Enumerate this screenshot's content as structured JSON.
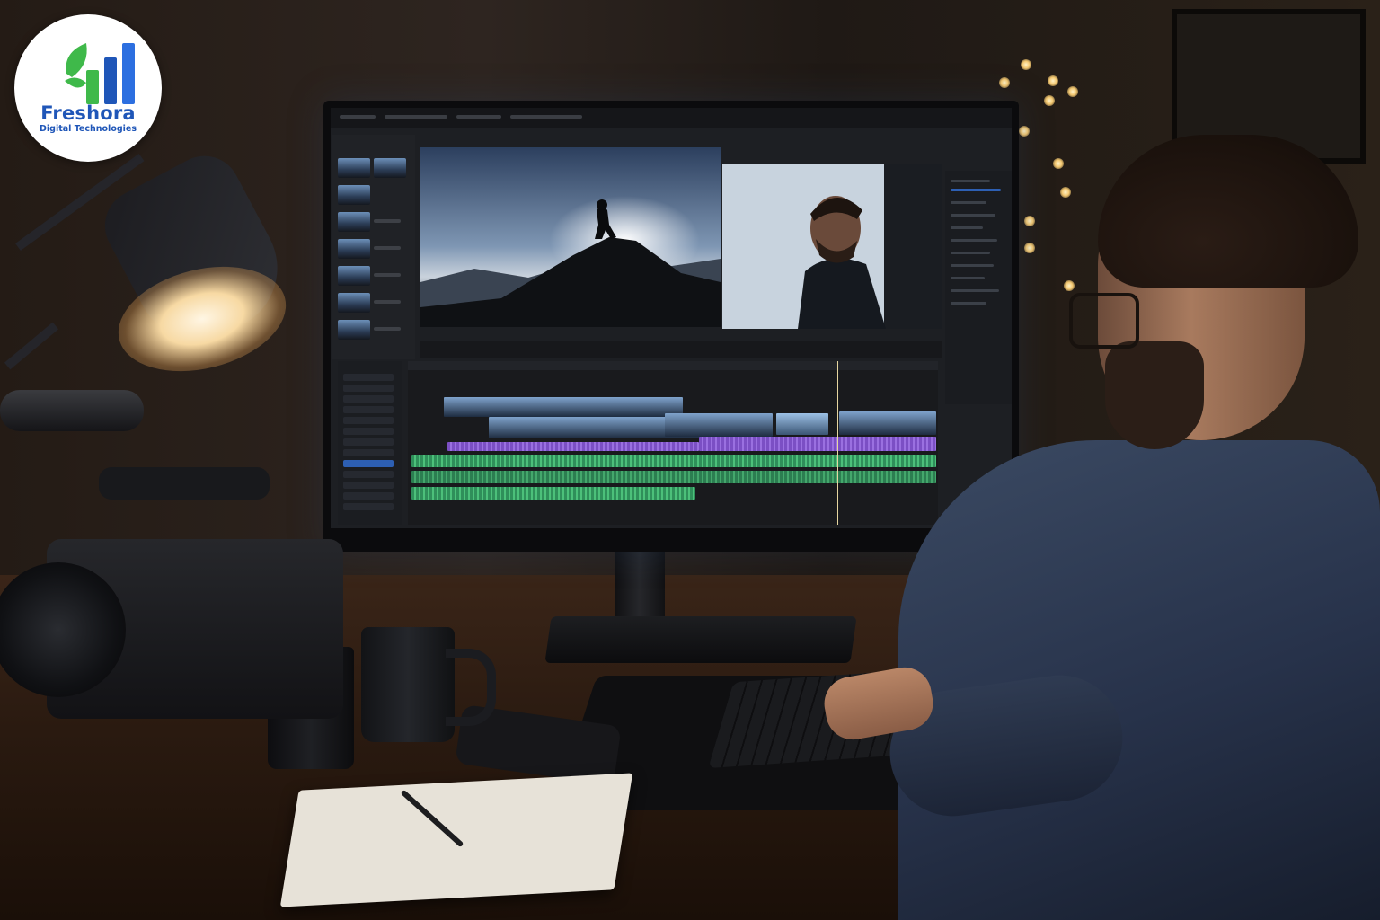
{
  "logo": {
    "brand": "Freshora",
    "tagline": "Digital Technologies",
    "colors": {
      "leaf": "#3fb94a",
      "bars": "#1f56b8",
      "text": "#1f56b8"
    }
  },
  "scene": {
    "description_icons": [
      "monitor-icon",
      "camera-icon",
      "lamp-icon",
      "keyboard-icon",
      "mug-icon",
      "notebook-icon"
    ],
    "accent_colors": {
      "lamp_glow": "#f7d9a3",
      "timeline_purple": "#8a5fd6",
      "timeline_green": "#3fae6a",
      "selection_blue": "#2d5fb3"
    }
  }
}
